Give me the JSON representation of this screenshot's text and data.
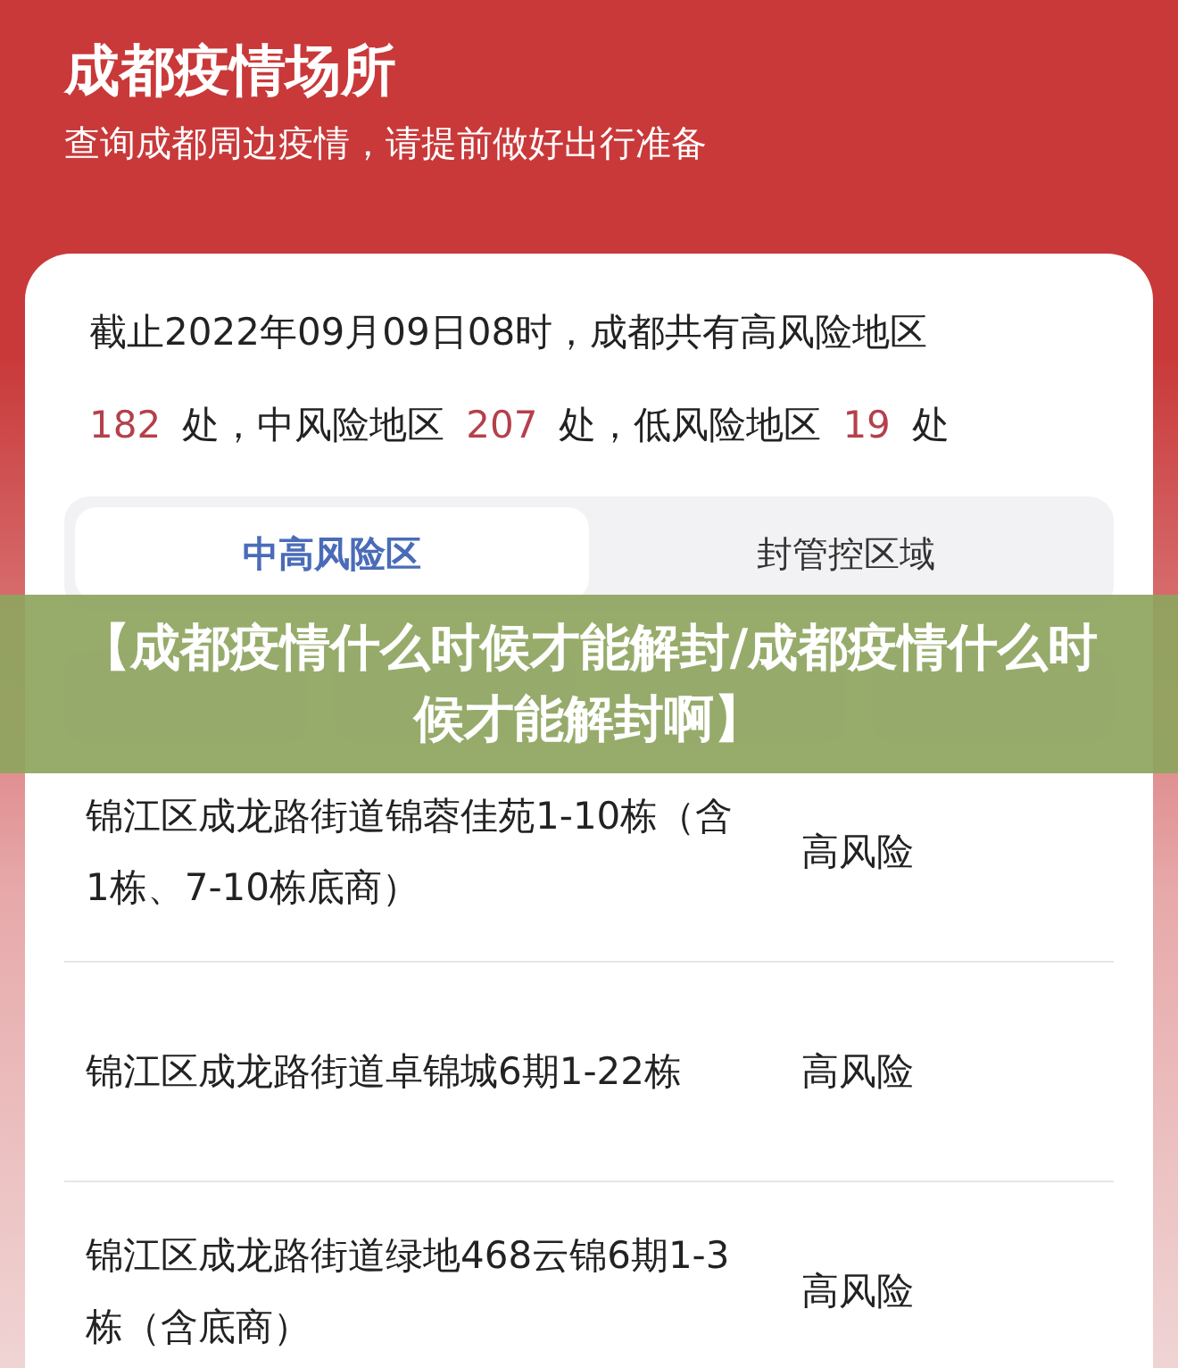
{
  "header": {
    "title": "成都疫情场所",
    "subtitle": "查询成都周边疫情，请提前做好出行准备"
  },
  "summary": {
    "line": "截止2022年09月09日08时，成都共有高风险地区",
    "segments": [
      {
        "text": "182",
        "highlight": true
      },
      {
        "text": "处，中风险地区",
        "highlight": false
      },
      {
        "text": "207",
        "highlight": true
      },
      {
        "text": "处，低风险地区",
        "highlight": false
      },
      {
        "text": "19",
        "highlight": true
      },
      {
        "text": "处",
        "highlight": false
      }
    ]
  },
  "tabs": [
    {
      "label": "中高风险区",
      "selected": true
    },
    {
      "label": "封管控区域",
      "selected": false
    }
  ],
  "banner": {
    "text": "【成都疫情什么时候才能解封/成都疫情什么时候才能解封啊】"
  },
  "rows": [
    {
      "place": "锦江区成龙路街道锦蓉佳苑1-10栋（含1栋、7-10栋底商）",
      "risk": "高风险"
    },
    {
      "place": "锦江区成龙路街道卓锦城6期1-22栋",
      "risk": "高风险"
    },
    {
      "place": "锦江区成龙路街道绿地468云锦6期1-3栋（含底商）",
      "risk": "高风险"
    }
  ]
}
